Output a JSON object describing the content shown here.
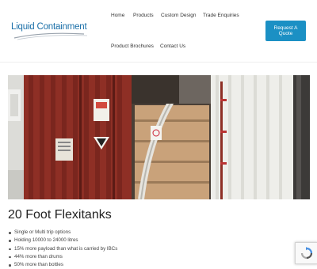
{
  "brand": {
    "logo_text": "Liquid Containment"
  },
  "nav": {
    "items": [
      {
        "label": "Home"
      },
      {
        "label": "Products"
      },
      {
        "label": "Custom Design"
      },
      {
        "label": "Trade Enquiries"
      },
      {
        "label": "Product Brochures"
      },
      {
        "label": "Contact Us"
      }
    ],
    "cta_label": "Request A Quote"
  },
  "hero": {
    "icon": "shipping-container-flexitank-photo"
  },
  "page": {
    "title": "20 Foot Flexitanks",
    "features": [
      "Single or Multi trip options",
      "Holding 10000 to 24000 litres",
      "15% more payload than what is carried by IBCs",
      "44% more than drums",
      "50% more than bottles"
    ]
  },
  "colors": {
    "brand_blue": "#1b90c4",
    "logo_blue": "#1a6fa8",
    "container_red": "#8e2f25"
  }
}
